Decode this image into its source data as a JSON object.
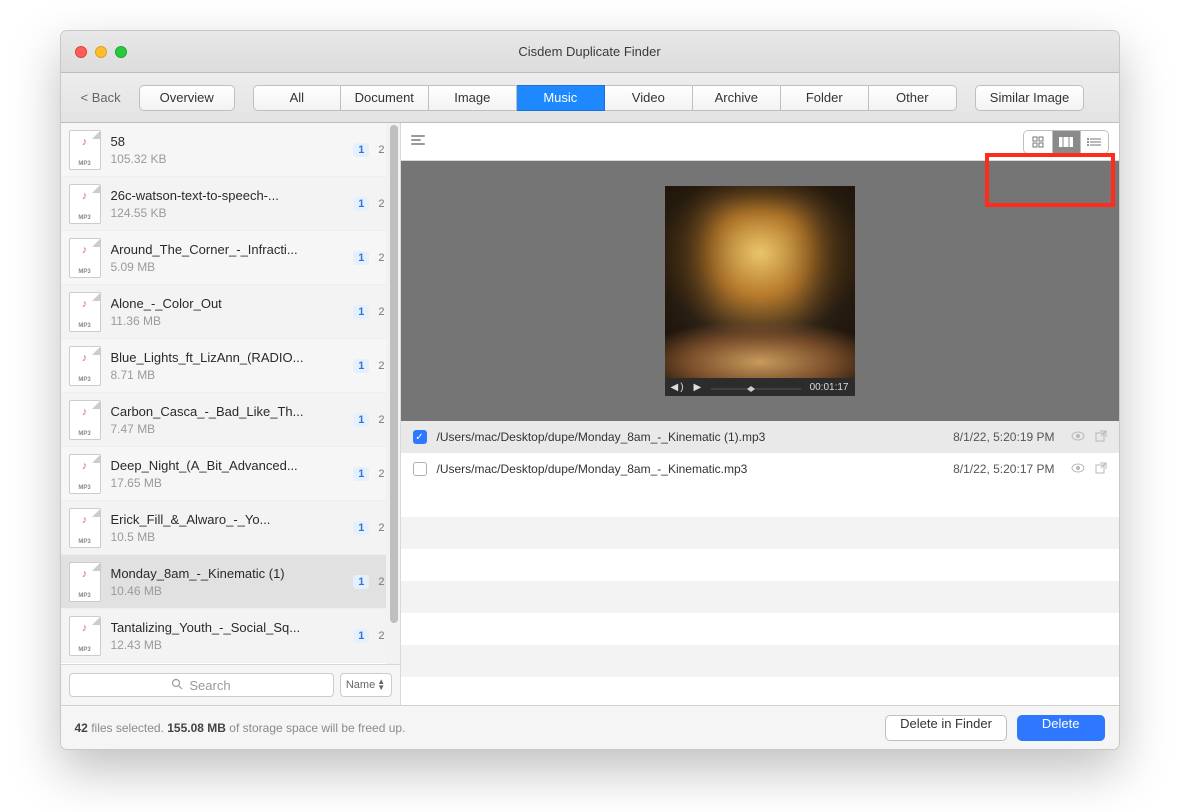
{
  "title": "Cisdem Duplicate Finder",
  "back_label": "< Back",
  "overview_label": "Overview",
  "tabs": [
    "All",
    "Document",
    "Image",
    "Music",
    "Video",
    "Archive",
    "Folder",
    "Other"
  ],
  "active_tab": "Music",
  "similar_label": "Similar Image",
  "list": [
    {
      "name": "58",
      "size": "105.32 KB",
      "c1": "1",
      "c2": "2"
    },
    {
      "name": "26c-watson-text-to-speech-...",
      "size": "124.55 KB",
      "c1": "1",
      "c2": "2"
    },
    {
      "name": "Around_The_Corner_-_Infracti...",
      "size": "5.09 MB",
      "c1": "1",
      "c2": "2"
    },
    {
      "name": "Alone_-_Color_Out",
      "size": "11.36 MB",
      "c1": "1",
      "c2": "2"
    },
    {
      "name": "Blue_Lights_ft_LizAnn_(RADIO...",
      "size": "8.71 MB",
      "c1": "1",
      "c2": "2"
    },
    {
      "name": "Carbon_Casca_-_Bad_Like_Th...",
      "size": "7.47 MB",
      "c1": "1",
      "c2": "2"
    },
    {
      "name": "Deep_Night_(A_Bit_Advanced...",
      "size": "17.65 MB",
      "c1": "1",
      "c2": "2"
    },
    {
      "name": "Erick_Fill_&amp;_Alwaro_-_Yo...",
      "size": "10.5 MB",
      "c1": "1",
      "c2": "2"
    },
    {
      "name": "Monday_8am_-_Kinematic (1)",
      "size": "10.46 MB",
      "c1": "1",
      "c2": "2",
      "selected": true
    },
    {
      "name": "Tantalizing_Youth_-_Social_Sq...",
      "size": "12.43 MB",
      "c1": "1",
      "c2": "2"
    }
  ],
  "search_placeholder": "Search",
  "sort_label": "Name",
  "play_time": "00:01:17",
  "duplicates": [
    {
      "checked": true,
      "path": "/Users/mac/Desktop/dupe/Monday_8am_-_Kinematic (1).mp3",
      "date": "8/1/22, 5:20:19 PM",
      "selected": true
    },
    {
      "checked": false,
      "path": "/Users/mac/Desktop/dupe/Monday_8am_-_Kinematic.mp3",
      "date": "8/1/22, 5:20:17 PM",
      "selected": false
    }
  ],
  "footer": {
    "count": "42",
    "t1": "files selected.",
    "size": "155.08 MB",
    "t2": "of storage space will be freed up."
  },
  "delete_finder": "Delete in Finder",
  "delete": "Delete",
  "mp3_label": "MP3"
}
